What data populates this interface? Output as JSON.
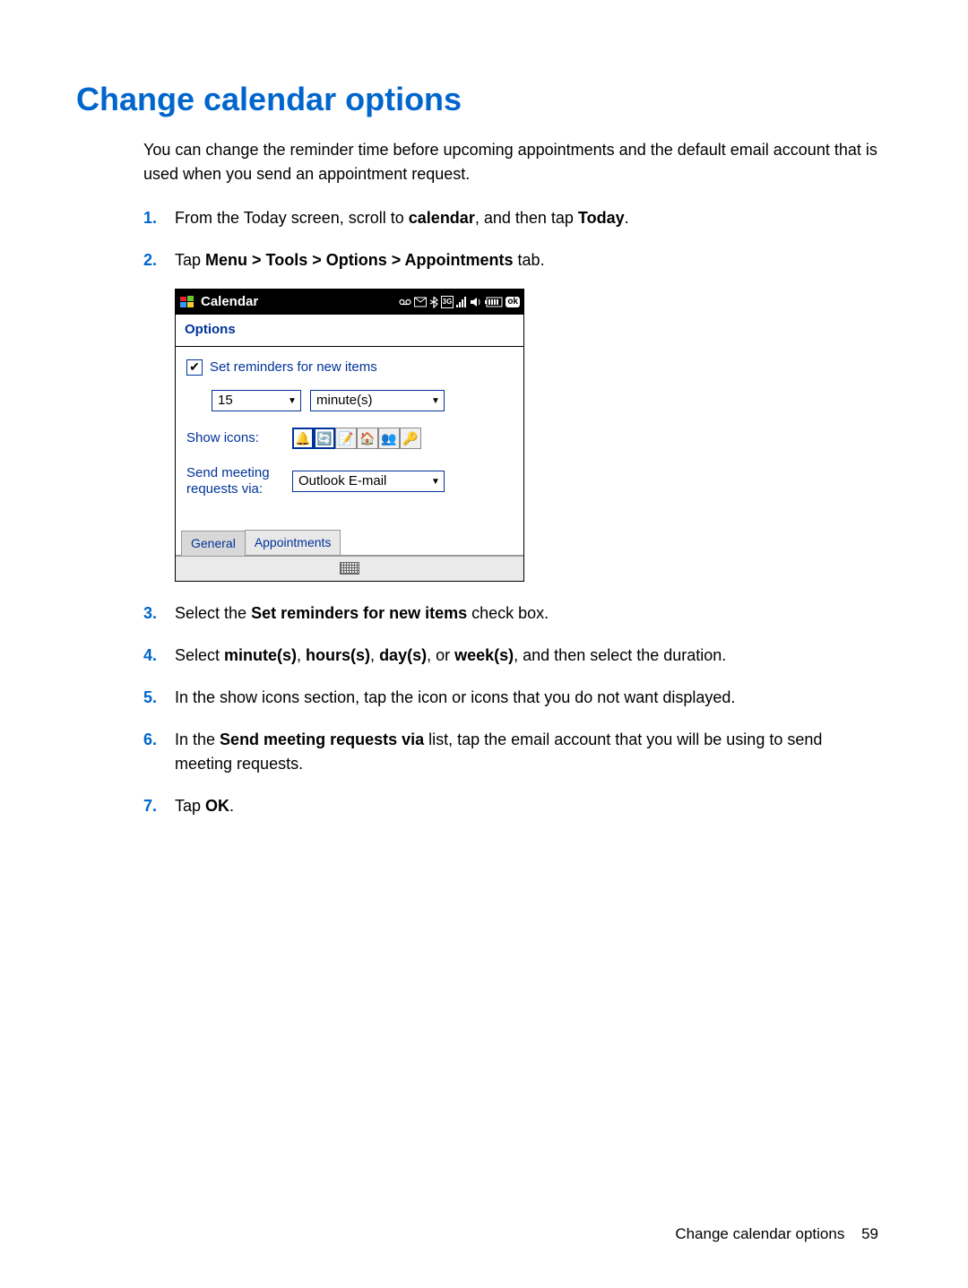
{
  "heading": "Change calendar options",
  "intro": "You can change the reminder time before upcoming appointments and the default email account that is used when you send an appointment request.",
  "steps": {
    "s1": {
      "prefix": "From the Today screen, scroll to ",
      "b1": "calendar",
      "mid": ", and then tap ",
      "b2": "Today",
      "suffix": "."
    },
    "s2": {
      "prefix": "Tap ",
      "b1": "Menu > Tools > Options > Appointments",
      "suffix": " tab."
    },
    "s3": {
      "prefix": "Select the ",
      "b1": "Set reminders for new items",
      "suffix": " check box."
    },
    "s4": {
      "prefix": "Select ",
      "b1": "minute(s)",
      "c1": ", ",
      "b2": "hours(s)",
      "c2": ", ",
      "b3": "day(s)",
      "c3": ", or ",
      "b4": "week(s)",
      "suffix": ", and then select the duration."
    },
    "s5": {
      "text": "In the show icons section, tap the icon or icons that you do not want displayed."
    },
    "s6": {
      "prefix": "In the ",
      "b1": "Send meeting requests via",
      "suffix": " list, tap the email account that you will be using to send meeting requests."
    },
    "s7": {
      "prefix": "Tap ",
      "b1": "OK",
      "suffix": "."
    }
  },
  "device": {
    "title": "Calendar",
    "ok": "ok",
    "subheader": "Options",
    "checkbox_label": "Set reminders for new items",
    "reminder_value": "15",
    "reminder_unit": "minute(s)",
    "show_icons_label": "Show icons:",
    "send_label": "Send meeting\nrequests via:",
    "send_value": "Outlook E-mail",
    "tabs": {
      "general": "General",
      "appointments": "Appointments"
    },
    "icons": [
      "🔔",
      "🔄",
      "📝",
      "🏠",
      "👥",
      "🔑"
    ]
  },
  "footer": {
    "label": "Change calendar options",
    "page": "59"
  }
}
